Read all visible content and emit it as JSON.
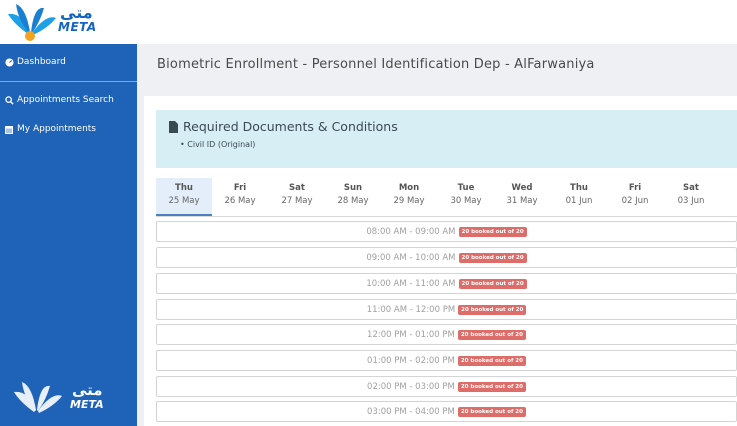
{
  "brand": {
    "name_arabic": "متى",
    "name_latin": "META",
    "color": "#1565c0"
  },
  "sidebar": {
    "items": [
      {
        "label": "Dashboard",
        "icon": "dashboard-icon"
      },
      {
        "label": "Appointments Search",
        "icon": "search-icon"
      },
      {
        "label": "My Appointments",
        "icon": "calendar-icon"
      }
    ]
  },
  "page": {
    "title": "Biometric Enrollment - Personnel Identification Dep - AlFarwaniya"
  },
  "requirements": {
    "title": "Required Documents & Conditions",
    "items": [
      "Civil ID (Original)"
    ]
  },
  "days": [
    {
      "name": "Thu",
      "date": "25 May",
      "active": true
    },
    {
      "name": "Fri",
      "date": "26 May"
    },
    {
      "name": "Sat",
      "date": "27 May"
    },
    {
      "name": "Sun",
      "date": "28 May"
    },
    {
      "name": "Mon",
      "date": "29 May"
    },
    {
      "name": "Tue",
      "date": "30 May"
    },
    {
      "name": "Wed",
      "date": "31 May"
    },
    {
      "name": "Thu",
      "date": "01 Jun"
    },
    {
      "name": "Fri",
      "date": "02 Jun"
    },
    {
      "name": "Sat",
      "date": "03 Jun"
    }
  ],
  "slots": [
    {
      "time": "08:00 AM - 09:00 AM",
      "badge": "20 booked out of 20"
    },
    {
      "time": "09:00 AM - 10:00 AM",
      "badge": "20 booked out of 20"
    },
    {
      "time": "10:00 AM - 11:00 AM",
      "badge": "20 booked out of 20"
    },
    {
      "time": "11:00 AM - 12:00 PM",
      "badge": "20 booked out of 20"
    },
    {
      "time": "12:00 PM - 01:00 PM",
      "badge": "20 booked out of 20"
    },
    {
      "time": "01:00 PM - 02:00 PM",
      "badge": "20 booked out of 20"
    },
    {
      "time": "02:00 PM - 03:00 PM",
      "badge": "20 booked out of 20"
    },
    {
      "time": "03:00 PM - 04:00 PM",
      "badge": "20 booked out of 20"
    }
  ],
  "colors": {
    "sidebar": "#1f63b8",
    "badge": "#d9534f",
    "info_box": "#d7eef4"
  }
}
